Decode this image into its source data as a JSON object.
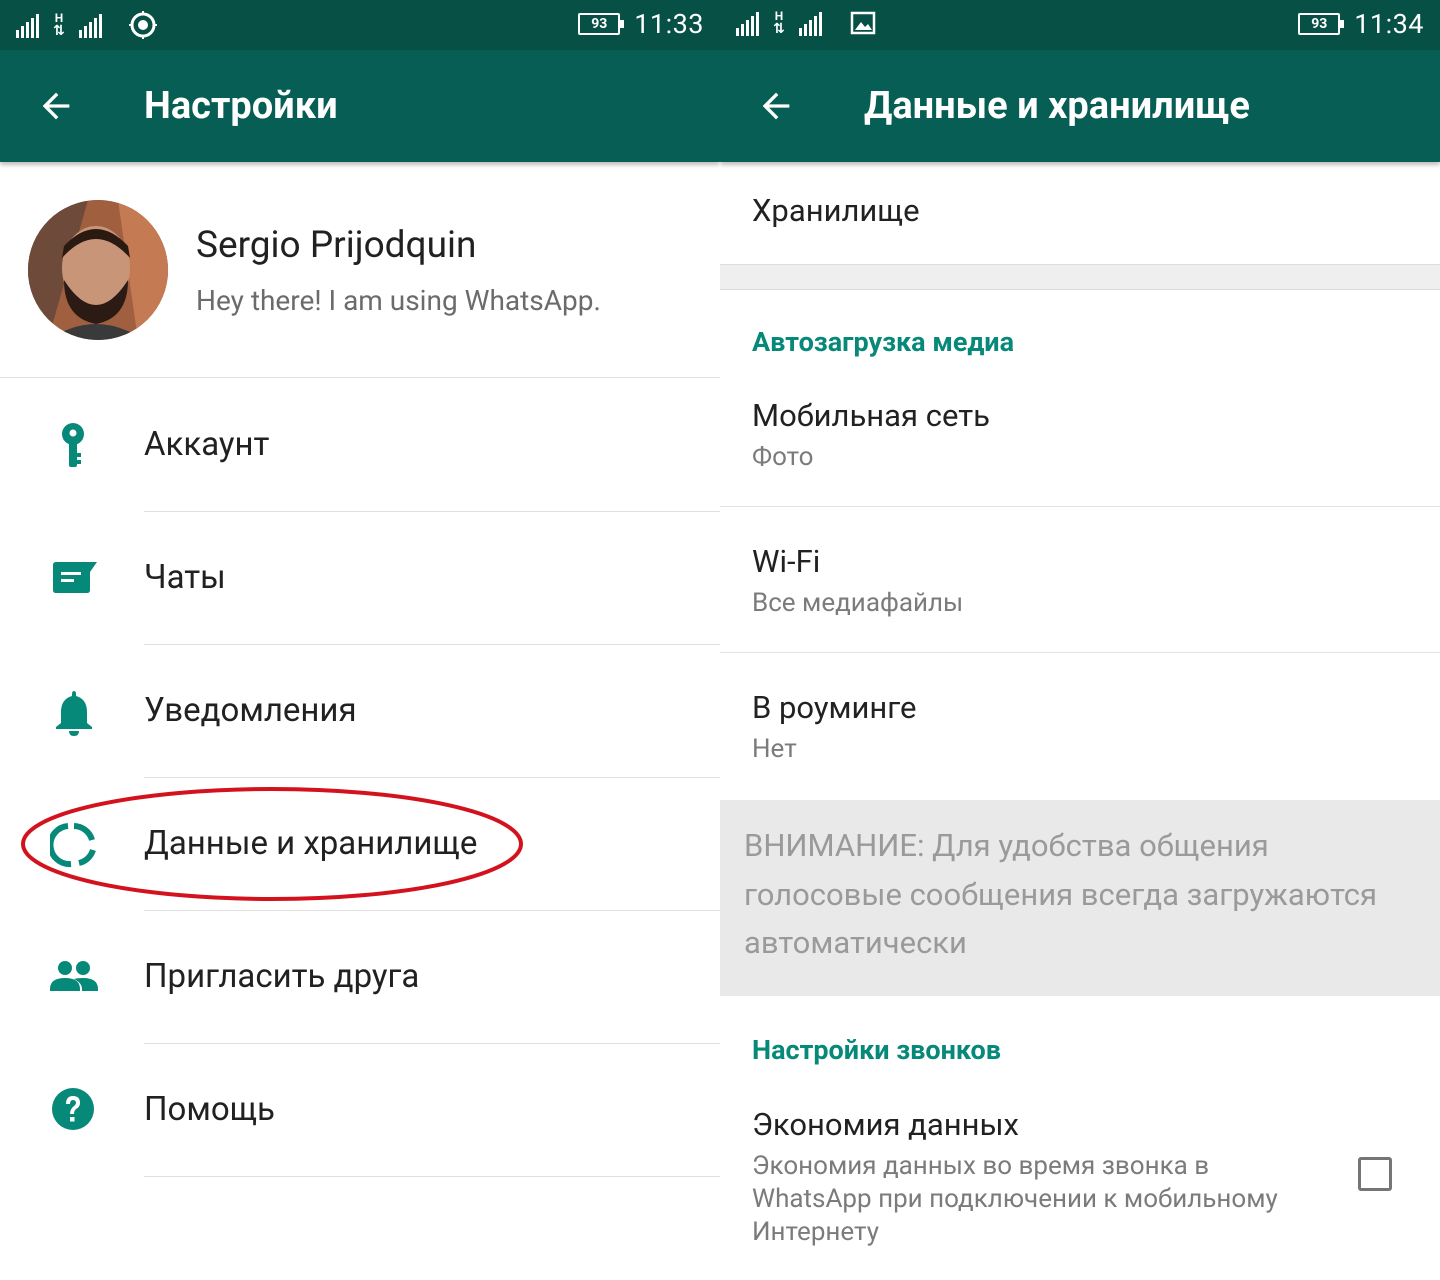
{
  "left": {
    "status_bar": {
      "battery": "93",
      "time": "11:33"
    },
    "toolbar": {
      "title": "Настройки",
      "back_icon": "arrow-back-icon"
    },
    "profile": {
      "name": "Sergio Prijodquin",
      "status": "Hey there! I am using WhatsApp."
    },
    "menu": [
      {
        "label": "Аккаунт",
        "icon": "key-icon"
      },
      {
        "label": "Чаты",
        "icon": "chat-icon"
      },
      {
        "label": "Уведомления",
        "icon": "bell-icon"
      },
      {
        "label": "Данные и хранилище",
        "icon": "data-usage-icon"
      },
      {
        "label": "Пригласить друга",
        "icon": "people-icon"
      },
      {
        "label": "Помощь",
        "icon": "help-icon"
      }
    ],
    "highlighted_item": "Данные и хранилище"
  },
  "right": {
    "status_bar": {
      "battery": "93",
      "time": "11:34"
    },
    "toolbar": {
      "title": "Данные и хранилище",
      "back_icon": "arrow-back-icon"
    },
    "storage": {
      "title": "Хранилище"
    },
    "autodownload": {
      "header": "Автозагрузка медиа",
      "items": [
        {
          "title": "Мобильная сеть",
          "value": "Фото"
        },
        {
          "title": "Wi-Fi",
          "value": "Все медиафайлы"
        },
        {
          "title": "В роуминге",
          "value": "Нет"
        }
      ]
    },
    "note": "ВНИМАНИЕ: Для удобства общения голосовые сообщения всегда загружаются автоматически",
    "calls": {
      "header": "Настройки звонков",
      "data_saving": {
        "title": "Экономия данных",
        "description": "Экономия данных во время звонка в WhatsApp при подключении к мобильному Интернету",
        "checked": false
      }
    }
  },
  "colors": {
    "toolbar": "#075e54",
    "status_bar": "#075046",
    "accent": "#07897a",
    "highlight_ring": "#d3121e"
  }
}
